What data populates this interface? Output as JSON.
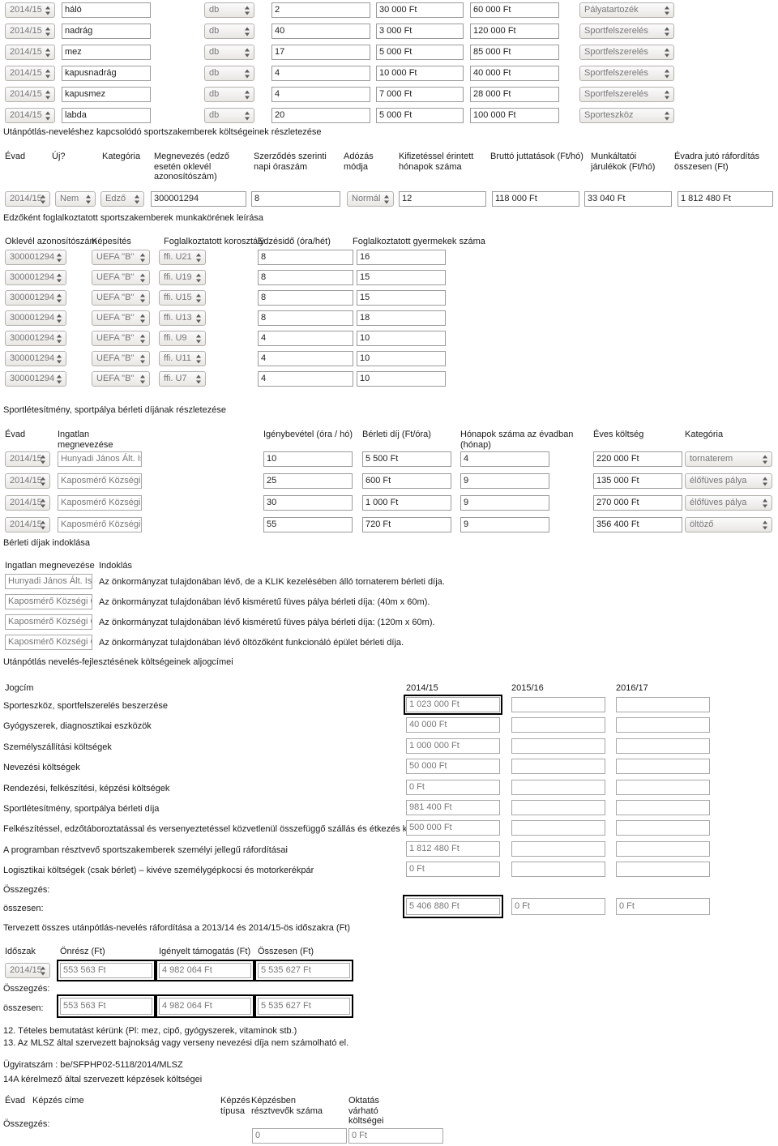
{
  "equipment_table": {
    "season_options": [
      "2014/15"
    ],
    "unit_options": [
      "db"
    ],
    "rows": [
      {
        "season": "2014/15",
        "name": "háló",
        "unit": "db",
        "qty": "2",
        "unit_price": "30 000 Ft",
        "total": "60 000  Ft",
        "category": "Pályatartozék"
      },
      {
        "season": "2014/15",
        "name": "nadrág",
        "unit": "db",
        "qty": "40",
        "unit_price": "3 000 Ft",
        "total": "120 000  Ft",
        "category": "Sportfelszerelés"
      },
      {
        "season": "2014/15",
        "name": "mez",
        "unit": "db",
        "qty": "17",
        "unit_price": "5 000 Ft",
        "total": "85 000  Ft",
        "category": "Sportfelszerelés"
      },
      {
        "season": "2014/15",
        "name": "kapusnadrág",
        "unit": "db",
        "qty": "4",
        "unit_price": "10 000 Ft",
        "total": "40 000  Ft",
        "category": "Sportfelszerelés"
      },
      {
        "season": "2014/15",
        "name": "kapusmez",
        "unit": "db",
        "qty": "4",
        "unit_price": "7 000 Ft",
        "total": "28 000  Ft",
        "category": "Sportfelszerelés"
      },
      {
        "season": "2014/15",
        "name": "labda",
        "unit": "db",
        "qty": "20",
        "unit_price": "5 000 Ft",
        "total": "100 000  Ft",
        "category": "Sporteszköz"
      }
    ]
  },
  "staff_section": {
    "title": "Utánpótlás-neveléshez kapcsolódó sportszakemberek költségeinek részletezése",
    "headers": {
      "season": "Évad",
      "new": "Új?",
      "category": "Kategória",
      "name": "Megnevezés (edző esetén oklevél azonosítószám)",
      "hours": "Szerződés szerinti napi óraszám",
      "tax": "Adózás módja",
      "months": "Kifizetéssel érintett hónapok száma",
      "gross": "Bruttó juttatások (Ft/hó)",
      "contrib": "Munkáltatói járulékok (Ft/hó)",
      "yearly": "Évadra jutó ráfordítás összesen (Ft)"
    },
    "rows": [
      {
        "season": "2014/15",
        "new": "Nem",
        "category": "Edző",
        "name": "300001294",
        "hours": "8",
        "tax": "Normál",
        "months": "12",
        "gross": "118 000 Ft",
        "contrib": "33 040  Ft",
        "yearly": "1 812 480  Ft"
      }
    ]
  },
  "job_section": {
    "title": "Edzőként foglalkoztatott sportszakemberek munkakörének leírása",
    "headers": {
      "licence": "Oklevél azonosítószám",
      "qualification": "Képesítés",
      "agegroup": "Foglalkoztatott korosztály",
      "traintime": "Edzésidő (óra/hét)",
      "children": "Foglalkoztatott gyermekek száma"
    },
    "rows": [
      {
        "licence": "300001294",
        "qualification": "UEFA \"B\"",
        "agegroup": "ffi. U21",
        "traintime": "8",
        "children": "16"
      },
      {
        "licence": "300001294",
        "qualification": "UEFA \"B\"",
        "agegroup": "ffi. U19",
        "traintime": "8",
        "children": "15"
      },
      {
        "licence": "300001294",
        "qualification": "UEFA \"B\"",
        "agegroup": "ffi. U15",
        "traintime": "8",
        "children": "15"
      },
      {
        "licence": "300001294",
        "qualification": "UEFA \"B\"",
        "agegroup": "ffi. U13",
        "traintime": "8",
        "children": "18"
      },
      {
        "licence": "300001294",
        "qualification": "UEFA \"B\"",
        "agegroup": "ffi. U9",
        "traintime": "4",
        "children": "10"
      },
      {
        "licence": "300001294",
        "qualification": "UEFA \"B\"",
        "agegroup": "ffi. U11",
        "traintime": "4",
        "children": "10"
      },
      {
        "licence": "300001294",
        "qualification": "UEFA \"B\"",
        "agegroup": "ffi. U7",
        "traintime": "4",
        "children": "10"
      }
    ]
  },
  "rental_section": {
    "title": "Sportlétesítmény, sportpálya bérleti díjának részletezése",
    "headers": {
      "season": "Évad",
      "property": "Ingatlan megnevezése",
      "usage": "Igénybevétel (óra / hó)",
      "fee": "Bérleti díj (Ft/óra)",
      "months": "Hónapok száma az évadban (hónap)",
      "yearly": "Éves költség",
      "category": "Kategória"
    },
    "rows": [
      {
        "season": "2014/15",
        "property": "Hunyadi János Ált. Isk.",
        "usage": "10",
        "fee": "5 500 Ft",
        "months": "4",
        "yearly": "220 000  Ft",
        "category": "tornaterem"
      },
      {
        "season": "2014/15",
        "property": "Kaposmérő Községi Ön",
        "usage": "25",
        "fee": "600 Ft",
        "months": "9",
        "yearly": "135 000  Ft",
        "category": "élőfüves pálya"
      },
      {
        "season": "2014/15",
        "property": "Kaposmérő Községi Ön",
        "usage": "30",
        "fee": "1 000 Ft",
        "months": "9",
        "yearly": "270 000  Ft",
        "category": "élőfüves pálya"
      },
      {
        "season": "2014/15",
        "property": "Kaposmérő Községi Ön",
        "usage": "55",
        "fee": "720 Ft",
        "months": "9",
        "yearly": "356 400  Ft",
        "category": "öltöző"
      }
    ]
  },
  "justification_section": {
    "title": "Bérleti díjak indoklása",
    "headers": {
      "property": "Ingatlan megnevezése",
      "reason": "Indoklás"
    },
    "rows": [
      {
        "property": "Hunyadi János Ált. Isk.",
        "reason": "Az önkormányzat tulajdonában lévő, de a KLIK kezelésében álló tornaterem bérleti díja."
      },
      {
        "property": "Kaposmérő Községi Ön",
        "reason": "Az önkormányzat tulajdonában lévő kisméretű füves pálya bérleti díja: (40m x 60m)."
      },
      {
        "property": "Kaposmérő Községi Ön",
        "reason": "Az önkormányzat tulajdonában lévő kisméretű füves pálya bérleti díja: (120m x 60m)."
      },
      {
        "property": "Kaposmérő Községi Ön",
        "reason": "Az önkormányzat tulajdonában lévő öltözőként funkcionáló épület bérleti díja."
      }
    ]
  },
  "cost_section": {
    "title": "Utánpótlás nevelés-fejlesztésének költségeinek aljogcímei",
    "col_title": "Jogcím",
    "years": [
      "2014/15",
      "2015/16",
      "2016/17"
    ],
    "rows": [
      {
        "label": "Sporteszköz, sportfelszerelés beszerzése",
        "y1": "1 023 000  Ft",
        "y2": "",
        "y3": "",
        "focused": true
      },
      {
        "label": "Gyógyszerek, diagnosztikai eszközök",
        "y1": "40 000  Ft",
        "y2": "",
        "y3": "",
        "focused": false
      },
      {
        "label": "Személyszállítási költségek",
        "y1": "1 000 000 Ft",
        "y2": "",
        "y3": "",
        "focused": false
      },
      {
        "label": "Nevezési költségek",
        "y1": "50 000 Ft",
        "y2": "",
        "y3": "",
        "focused": false
      },
      {
        "label": "Rendezési, felkészítési, képzési költségek",
        "y1": "0 Ft",
        "y2": "",
        "y3": "",
        "focused": false
      },
      {
        "label": "Sportlétesítmény, sportpálya bérleti díja",
        "y1": "981 400  Ft",
        "y2": "",
        "y3": "",
        "focused": false
      },
      {
        "label": "Felkészítéssel, edzőtáboroztatással és versenyeztetéssel közvetlenül összefüggő szállás és étkezés költsége",
        "y1": "500 000 Ft",
        "y2": "",
        "y3": "",
        "focused": false
      },
      {
        "label": "A programban résztvevő sportszakemberek személyi jellegű ráfordításai",
        "y1": "1 812 480  Ft",
        "y2": "",
        "y3": "",
        "focused": false
      },
      {
        "label": "Logisztikai költségek (csak bérlet) – kivéve személygépkocsi és motorkerékpár",
        "y1": "0 Ft",
        "y2": "",
        "y3": "",
        "focused": false
      }
    ],
    "summary_label": "Összegzés:",
    "total_label": "összesen:",
    "totals": {
      "y1": "5 406 880 Ft",
      "y2": "0 Ft",
      "y3": "0 Ft"
    }
  },
  "planned_section": {
    "title": "Tervezett összes utánpótlás-nevelés ráfordítása a 2013/14 és 2014/15-ös időszakra (Ft)",
    "headers": {
      "period": "Időszak",
      "own": "Önrész (Ft)",
      "requested": "Igényelt támogatás (Ft)",
      "total": "Összesen (Ft)"
    },
    "rows": [
      {
        "period": "2014/15",
        "own": "553 563 Ft",
        "requested": "4 982 064 Ft",
        "total": "5 535 627 Ft"
      }
    ],
    "summary_label": "Összegzés:",
    "total_label": "összesen:",
    "totals": {
      "own": "553 563 Ft",
      "requested": "4 982 064 Ft",
      "total": "5 535 627 Ft"
    }
  },
  "footnotes": [
    "12. Tételes bemutatást kérünk (Pl: mez, cipő, gyógyszerek, vitaminok stb.)",
    "13. Az MLSZ által szervezett bajnokság vagy verseny nevezési díja nem számolható el."
  ],
  "footer": {
    "case_number": "Ügyiratszám : be/SFPHP02-5118/2014/MLSZ",
    "training_title": "14A kérelmező által szervezett képzések költségei",
    "headers": {
      "season": "Évad",
      "course": "Képzés címe",
      "type": "Képzés típusa",
      "participants": "Képzésben résztvevők száma",
      "cost": "Oktatás várható költségei"
    },
    "summary_label": "Összegzés:",
    "totals": {
      "participants": "0",
      "cost": "0 Ft"
    }
  }
}
